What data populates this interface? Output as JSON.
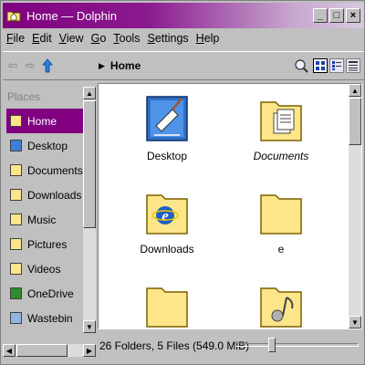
{
  "window": {
    "title": "Home — Dolphin",
    "buttons": {
      "minimize": "_",
      "maximize": "□",
      "close": "×"
    }
  },
  "menu": [
    "File",
    "Edit",
    "View",
    "Go",
    "Tools",
    "Settings",
    "Help"
  ],
  "toolbar": {
    "breadcrumb": "Home",
    "icons": [
      "back-arrow-icon",
      "forward-arrow-icon",
      "up-arrow-icon",
      "breadcrumb-chevron-icon",
      "zoom-icon",
      "icons-view-icon",
      "compact-view-icon",
      "details-view-icon"
    ]
  },
  "places": {
    "header": "Places",
    "items": [
      {
        "label": "Home",
        "icon": "home-icon",
        "selected": true
      },
      {
        "label": "Desktop",
        "icon": "desktop-icon"
      },
      {
        "label": "Documents",
        "icon": "documents-icon"
      },
      {
        "label": "Downloads",
        "icon": "downloads-icon"
      },
      {
        "label": "Music",
        "icon": "music-icon"
      },
      {
        "label": "Pictures",
        "icon": "pictures-icon"
      },
      {
        "label": "Videos",
        "icon": "videos-icon"
      },
      {
        "label": "OneDrive",
        "icon": "onedrive-icon"
      },
      {
        "label": "Wastebin",
        "icon": "wastebin-icon"
      }
    ]
  },
  "files": [
    {
      "label": "Desktop",
      "icon": "desktop-folder-icon",
      "italic": false
    },
    {
      "label": "Documents",
      "icon": "documents-folder-icon",
      "italic": true
    },
    {
      "label": "Downloads",
      "icon": "downloads-folder-icon",
      "italic": false
    },
    {
      "label": "e",
      "icon": "folder-icon",
      "italic": false
    },
    {
      "label": "",
      "icon": "folder-icon",
      "italic": false
    },
    {
      "label": "",
      "icon": "music-folder-icon",
      "italic": false
    }
  ],
  "status": {
    "text": "26 Folders, 5 Files (549.0 MiB)",
    "zoom_level": 0.28
  },
  "colors": {
    "titlebar_start": "#800080",
    "titlebar_end": "#d8c8e0",
    "selection": "#800080",
    "folder": "#fde689"
  }
}
